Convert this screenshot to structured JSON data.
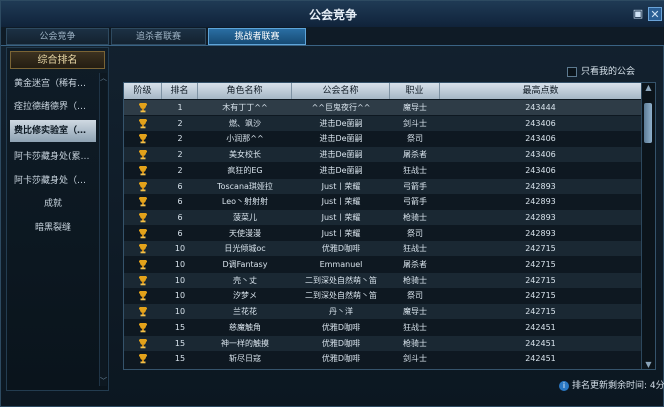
{
  "window": {
    "title": "公会竞争"
  },
  "tabs": [
    {
      "label": "公会竞争",
      "active": false
    },
    {
      "label": "追杀者联赛",
      "active": false
    },
    {
      "label": "挑战者联赛",
      "active": true
    }
  ],
  "sidebar": {
    "header": "综合排名",
    "items": [
      {
        "label": "黄金迷宫（稀有…",
        "selected": false
      },
      {
        "label": "痊拉德绪德界（…",
        "selected": false
      },
      {
        "label": "费比修实验室（…",
        "selected": true
      },
      {
        "label": "阿卡莎藏身处(累…",
        "selected": false
      },
      {
        "label": "阿卡莎藏身处（…",
        "selected": false
      },
      {
        "label": "成就",
        "selected": false
      },
      {
        "label": "暗黑裂缝",
        "selected": false
      }
    ]
  },
  "filter": {
    "only_mine_label": "只看我的公会"
  },
  "table": {
    "headers": [
      "阶级",
      "排名",
      "角色名称",
      "公会名称",
      "职业",
      "最高点数"
    ],
    "rows": [
      {
        "rank": "1",
        "name": "木有丁丁^^",
        "guild": "^^巨鬼夜行^^",
        "job": "魔导士",
        "points": "243444",
        "highlight": true
      },
      {
        "rank": "2",
        "name": "燃、飒沙",
        "guild": "进击De菌嗣",
        "job": "剑斗士",
        "points": "243406"
      },
      {
        "rank": "2",
        "name": "小润那^^",
        "guild": "进击De菌嗣",
        "job": "祭司",
        "points": "243406"
      },
      {
        "rank": "2",
        "name": "美女校长",
        "guild": "进击De菌嗣",
        "job": "屠杀者",
        "points": "243406"
      },
      {
        "rank": "2",
        "name": "疯狂的EG",
        "guild": "进击De菌嗣",
        "job": "狂战士",
        "points": "243406"
      },
      {
        "rank": "6",
        "name": "Toscana琪娅拉",
        "guild": "Just丨荣耀",
        "job": "弓箭手",
        "points": "242893"
      },
      {
        "rank": "6",
        "name": "Leo丶射射射",
        "guild": "Just丨荣耀",
        "job": "弓箭手",
        "points": "242893"
      },
      {
        "rank": "6",
        "name": "菠菜儿",
        "guild": "Just丨荣耀",
        "job": "枪骑士",
        "points": "242893"
      },
      {
        "rank": "6",
        "name": "天使漫漫",
        "guild": "Just丨荣耀",
        "job": "祭司",
        "points": "242893"
      },
      {
        "rank": "10",
        "name": "日光倾城oc",
        "guild": "优雅D咖啡",
        "job": "狂战士",
        "points": "242715"
      },
      {
        "rank": "10",
        "name": "D调Fantasy",
        "guild": "Emmanuel",
        "job": "屠杀者",
        "points": "242715"
      },
      {
        "rank": "10",
        "name": "壳丶丈",
        "guild": "二到深处自然萌丶笛",
        "job": "枪骑士",
        "points": "242715"
      },
      {
        "rank": "10",
        "name": "汐梦メ",
        "guild": "二到深处自然萌丶笛",
        "job": "祭司",
        "points": "242715"
      },
      {
        "rank": "10",
        "name": "兰花花",
        "guild": "丹丶洋",
        "job": "魔导士",
        "points": "242715"
      },
      {
        "rank": "15",
        "name": "慈魔触角",
        "guild": "优雅D咖啡",
        "job": "狂战士",
        "points": "242451"
      },
      {
        "rank": "15",
        "name": "神一样的触摸",
        "guild": "优雅D咖啡",
        "job": "枪骑士",
        "points": "242451"
      },
      {
        "rank": "15",
        "name": "斩尽日寇",
        "guild": "优雅D咖啡",
        "job": "剑斗士",
        "points": "242451"
      }
    ]
  },
  "footer": {
    "update_text": "排名更新剩余时间: 4分"
  },
  "colors": {
    "accent": "#2a6ea3",
    "trophy": "#e3a21a"
  }
}
